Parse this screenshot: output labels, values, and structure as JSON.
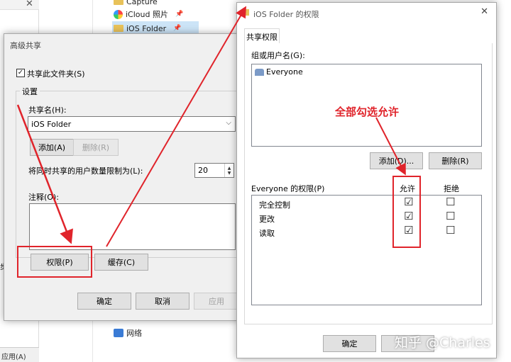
{
  "background": {
    "nav_items": [
      {
        "label": "Capture",
        "icon": "folder-icon"
      },
      {
        "label": "iCloud 照片",
        "icon": "icloud-icon"
      },
      {
        "label": "iOS Folder",
        "icon": "folder-icon"
      },
      {
        "label": "网络",
        "icon": "network-icon"
      }
    ],
    "status_left": "应用(A)",
    "left_partial_label": "步"
  },
  "advanced_sharing": {
    "title": "高级共享",
    "share_checkbox_label": "共享此文件夹(S)",
    "share_checked": true,
    "settings_group": "设置",
    "share_name_label": "共享名(H):",
    "share_name_value": "iOS Folder",
    "add_button": "添加(A)",
    "remove_button": "删除(R)",
    "user_limit_label": "将同时共享的用户数量限制为(L):",
    "user_limit_value": "20",
    "comment_label": "注释(O):",
    "permissions_button": "权限(P)",
    "caching_button": "缓存(C)",
    "ok_button": "确定",
    "cancel_button": "取消",
    "apply_button": "应用"
  },
  "permissions": {
    "title": "iOS Folder 的权限",
    "tab_label": "共享权限",
    "group_label": "组或用户名(G):",
    "users": [
      "Everyone"
    ],
    "add_button": "添加(D)...",
    "remove_button": "删除(R)",
    "perm_header": "Everyone 的权限(P)",
    "allow_header": "允许",
    "deny_header": "拒绝",
    "rows": [
      {
        "name": "完全控制",
        "allow": "☑",
        "deny": "☐"
      },
      {
        "name": "更改",
        "allow": "☑",
        "deny": "☐"
      },
      {
        "name": "读取",
        "allow": "☑",
        "deny": "☐"
      }
    ],
    "ok_button": "确定"
  },
  "annotation": {
    "callout": "全部勾选允许",
    "color": "#e0242b"
  },
  "watermark": "知乎 @Charles"
}
